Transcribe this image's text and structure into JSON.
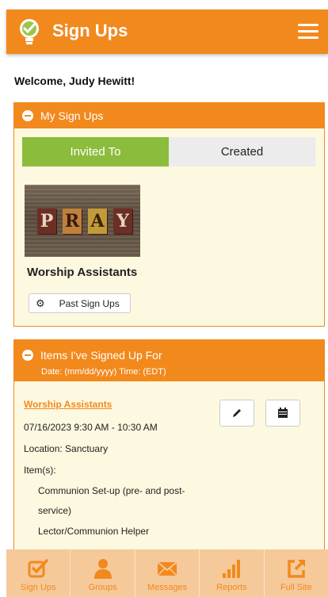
{
  "header": {
    "title": "Sign Ups"
  },
  "welcome": "Welcome, Judy Hewitt!",
  "my_signups": {
    "title": "My Sign Ups",
    "tabs": [
      {
        "label": "Invited To",
        "active": true
      },
      {
        "label": "Created",
        "active": false
      }
    ],
    "image_letters": [
      "P",
      "R",
      "A",
      "Y"
    ],
    "opportunity": "Worship Assistants",
    "past_button": "Past Sign Ups"
  },
  "signed_up": {
    "title": "Items I've Signed Up For",
    "subtitle": "Date: (mm/dd/yyyy) Time: (EDT)",
    "entry": {
      "name": "Worship Assistants",
      "datetime": "07/16/2023 9:30 AM - 10:30 AM",
      "location": "Location: Sanctuary",
      "items_label": "Item(s):",
      "items": [
        "Communion Set-up (pre- and post-",
        "service)",
        "Lector/Communion Helper"
      ]
    }
  },
  "bottom_nav": [
    {
      "label": "Sign Ups",
      "icon": "checkbox-edit-icon"
    },
    {
      "label": "Groups",
      "icon": "person-icon"
    },
    {
      "label": "Messages",
      "icon": "envelope-icon"
    },
    {
      "label": "Reports",
      "icon": "bar-chart-icon"
    },
    {
      "label": "Full Site",
      "icon": "external-link-icon"
    }
  ],
  "colors": {
    "accent": "#f2891d",
    "active_tab": "#8cbc3c",
    "panel_bg": "#fdf8e0",
    "nav_bg": "#f5c99a"
  }
}
